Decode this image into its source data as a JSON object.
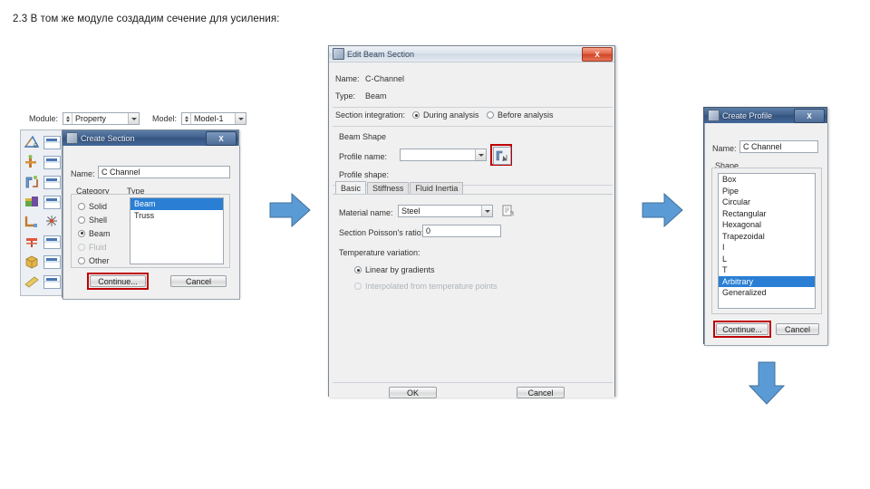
{
  "slide": {
    "title": "2.3 В том же модуле создадим сечение для усиления:"
  },
  "module_bar": {
    "module_label": "Module:",
    "module_value": "Property",
    "model_label": "Model:",
    "model_value": "Model-1"
  },
  "create_section_dialog": {
    "title": "Create Section",
    "close_label": "X",
    "name_label": "Name:",
    "name_value": "C Channel",
    "category_label": "Category",
    "type_label": "Type",
    "categories": [
      {
        "label": "Solid",
        "selected": false,
        "disabled": false
      },
      {
        "label": "Shell",
        "selected": false,
        "disabled": false
      },
      {
        "label": "Beam",
        "selected": true,
        "disabled": false
      },
      {
        "label": "Fluid",
        "selected": false,
        "disabled": true
      },
      {
        "label": "Other",
        "selected": false,
        "disabled": false
      }
    ],
    "types": [
      {
        "label": "Beam",
        "selected": true
      },
      {
        "label": "Truss",
        "selected": false
      }
    ],
    "continue_label": "Continue...",
    "cancel_label": "Cancel",
    "highlight_color": "#c00000"
  },
  "edit_beam_section_dialog": {
    "title": "Edit Beam Section",
    "close_label": "X",
    "name_label": "Name:",
    "name_value": "C-Channel",
    "type_label": "Type:",
    "type_value": "Beam",
    "section_integration_label": "Section integration:",
    "integration_options": [
      {
        "label": "During analysis",
        "selected": true
      },
      {
        "label": "Before analysis",
        "selected": false
      }
    ],
    "beam_shape_label": "Beam Shape",
    "profile_name_label": "Profile name:",
    "profile_name_value": "",
    "create_profile_button_name": "create-profile-icon",
    "profile_shape_label": "Profile shape:",
    "tabs": [
      {
        "label": "Basic",
        "active": true
      },
      {
        "label": "Stiffness",
        "active": false
      },
      {
        "label": "Fluid Inertia",
        "active": false
      }
    ],
    "material_name_label": "Material name:",
    "material_name_value": "Steel",
    "poisson_label": "Section Poisson's ratio:",
    "poisson_value": "0",
    "temperature_variation_label": "Temperature variation:",
    "temperature_options": [
      {
        "label": "Linear by gradients",
        "selected": true,
        "disabled": false
      },
      {
        "label": "Interpolated from temperature points",
        "selected": false,
        "disabled": true
      }
    ],
    "ok_label": "OK",
    "cancel_label": "Cancel",
    "highlight_color": "#c00000"
  },
  "create_profile_dialog": {
    "title": "Create Profile",
    "close_label": "X",
    "name_label": "Name:",
    "name_value": "C Channel",
    "shape_label": "Shape",
    "shapes": [
      {
        "label": "Box",
        "selected": false
      },
      {
        "label": "Pipe",
        "selected": false
      },
      {
        "label": "Circular",
        "selected": false
      },
      {
        "label": "Rectangular",
        "selected": false
      },
      {
        "label": "Hexagonal",
        "selected": false
      },
      {
        "label": "Trapezoidal",
        "selected": false
      },
      {
        "label": "I",
        "selected": false
      },
      {
        "label": "L",
        "selected": false
      },
      {
        "label": "T",
        "selected": false
      },
      {
        "label": "Arbitrary",
        "selected": true
      },
      {
        "label": "Generalized",
        "selected": false
      }
    ],
    "continue_label": "Continue...",
    "cancel_label": "Cancel",
    "highlight_color": "#c00000"
  },
  "arrows": {
    "color": "#5b9bd5",
    "stroke": "#41719c",
    "left_arrow_name": "flow-arrow-right-1",
    "right_arrow_name": "flow-arrow-right-2",
    "down_arrow_name": "flow-arrow-down"
  }
}
